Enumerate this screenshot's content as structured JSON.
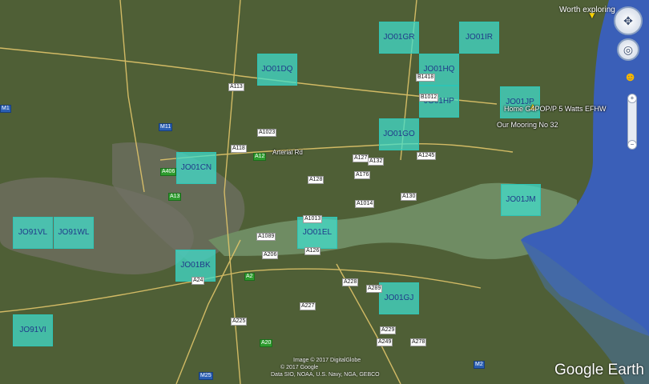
{
  "map": {
    "colors": {
      "land": "#4a5a34",
      "urban": "#6b6b5a",
      "estuary": "#6f8c63",
      "sea": "#3a5fb8",
      "grid_fill": "#40e0d0",
      "grid_label": "#203a8a"
    },
    "grid_squares": [
      "JO01GR",
      "JO01IR",
      "JO01DQ",
      "JO01HQ",
      "JO01HP",
      "JO01JP",
      "JO01GO",
      "JO01CN",
      "JO01JM",
      "JO91VL",
      "JO91WL",
      "JO01EL",
      "JO01BK",
      "JO01GJ",
      "JO91VI"
    ],
    "places": {
      "worth_exploring": "Worth exploring",
      "home_station": "Home G4POP/P 5 Watts EFHW",
      "mooring": "Our Mooring No 32"
    },
    "roads": {
      "a113": "A113",
      "a1023": "A1023",
      "a118": "A118",
      "a12": "A12",
      "a127": "A127",
      "a128": "A128",
      "a1245": "A1245",
      "a176": "A176",
      "a132": "A132",
      "a130": "A130",
      "a1014": "A1014",
      "b1418": "B1418",
      "b1012": "B1012",
      "a1013": "A1013",
      "a126": "A126",
      "a1089": "A1089",
      "a206": "A206",
      "a2": "A2",
      "a228": "A228",
      "a289": "A289",
      "a227": "A227",
      "a225": "A225",
      "a20": "A20",
      "a229": "A229",
      "a249": "A249",
      "a278": "A278",
      "m11": "M11",
      "m1": "M1",
      "m2": "M2",
      "m25": "M25",
      "a24": "A24",
      "a406": "A406",
      "a13": "A13"
    },
    "road_text": "Arterial Rd",
    "controls": {
      "compass": "compass-icon",
      "look": "look-icon",
      "zoom_in": "+",
      "zoom_out": "−",
      "pegman": "pegman-icon"
    },
    "attribution": {
      "line1": "Image © 2017 DigitalGlobe",
      "line2": "© 2017 Google",
      "line3": "Data SIO, NOAA, U.S. Navy, NGA, GEBCO"
    },
    "logo": "Google Earth"
  }
}
